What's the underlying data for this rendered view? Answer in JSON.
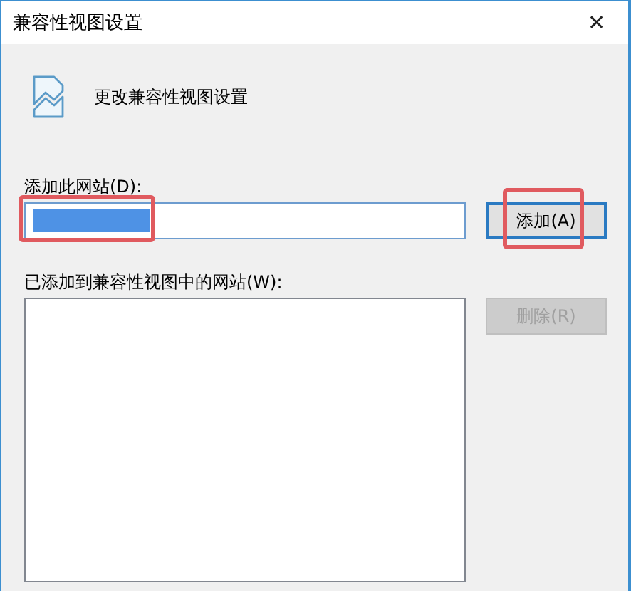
{
  "window": {
    "title": "兼容性视图设置",
    "close": "✕"
  },
  "header": {
    "text": "更改兼容性视图设置"
  },
  "add_site": {
    "label": "添加此网站(D):",
    "value_selected": true,
    "highlighted": true
  },
  "add_button": {
    "label": "添加(A)",
    "focused": true,
    "highlighted": true,
    "disabled": false
  },
  "sites_list": {
    "label": "已添加到兼容性视图中的网站(W):"
  },
  "remove_button": {
    "label": "删除(R)",
    "disabled": true
  }
}
